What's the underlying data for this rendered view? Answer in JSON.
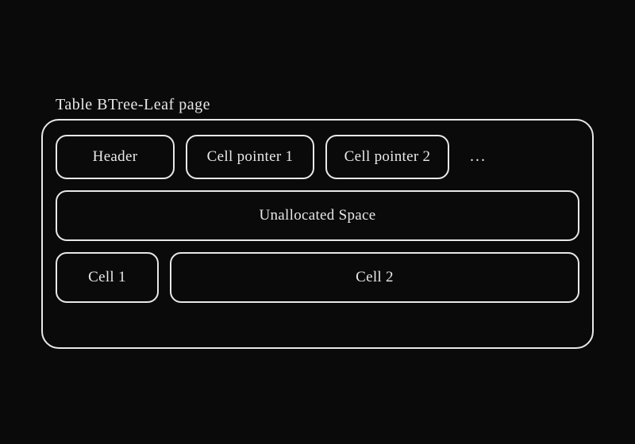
{
  "title": "Table BTree-Leaf page",
  "row1": {
    "header": "Header",
    "ptr1": "Cell pointer 1",
    "ptr2": "Cell pointer 2",
    "ellipsis": "..."
  },
  "row2": {
    "unallocated": "Unallocated Space"
  },
  "row3": {
    "cell1": "Cell 1",
    "cell2": "Cell 2"
  },
  "colors": {
    "bg": "#0a0a0a",
    "stroke": "#e8e8e8"
  }
}
